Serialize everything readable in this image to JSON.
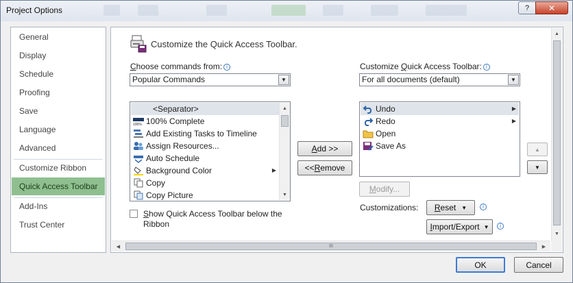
{
  "window": {
    "title": "Project Options",
    "help_label": "?",
    "close_label": "✕"
  },
  "nav": {
    "items": [
      {
        "label": "General"
      },
      {
        "label": "Display"
      },
      {
        "label": "Schedule"
      },
      {
        "label": "Proofing"
      },
      {
        "label": "Save"
      },
      {
        "label": "Language"
      },
      {
        "label": "Advanced"
      },
      {
        "label": "Customize Ribbon"
      },
      {
        "label": "Quick Access Toolbar",
        "active": true
      },
      {
        "label": "Add-Ins"
      },
      {
        "label": "Trust Center"
      }
    ]
  },
  "content": {
    "heading": "Customize the Quick Access Toolbar.",
    "choose_label_u": "C",
    "choose_label_rest": "hoose commands from:",
    "choose_value": "Popular Commands",
    "customize_label_pre": "Customize ",
    "customize_label_u": "Q",
    "customize_label_rest": "uick Access Toolbar:",
    "customize_value": "For all documents (default)",
    "commands": [
      {
        "label": "<Separator>",
        "icon": "none",
        "selected": true
      },
      {
        "label": "100% Complete",
        "icon": "percent-complete-icon"
      },
      {
        "label": "Add Existing Tasks to Timeline",
        "icon": "timeline-icon"
      },
      {
        "label": "Assign Resources...",
        "icon": "resources-icon"
      },
      {
        "label": "Auto Schedule",
        "icon": "auto-schedule-icon"
      },
      {
        "label": "Background Color",
        "icon": "paint-bucket-icon",
        "submenu": true
      },
      {
        "label": "Copy",
        "icon": "copy-icon"
      },
      {
        "label": "Copy Picture",
        "icon": "copy-picture-icon"
      }
    ],
    "toolbar_items": [
      {
        "label": "Undo",
        "icon": "undo-icon",
        "submenu": true,
        "selected": true
      },
      {
        "label": "Redo",
        "icon": "redo-icon",
        "submenu": true
      },
      {
        "label": "Open",
        "icon": "folder-icon"
      },
      {
        "label": "Save As",
        "icon": "save-as-icon"
      }
    ],
    "add_button_u": "A",
    "add_button_rest": "dd >>",
    "remove_button_pre": "<< ",
    "remove_button_u": "R",
    "remove_button_rest": "emove",
    "modify_button_u": "M",
    "modify_button_rest": "odify...",
    "show_below_u": "S",
    "show_below_line1_rest": "how Quick Access Toolbar below the",
    "show_below_line2": "Ribbon",
    "customizations_label": "Customizations:",
    "reset_u": "R",
    "reset_rest": "eset",
    "import_u": "I",
    "import_rest": "mport/Export",
    "info_glyph": "i",
    "hscroll_grip": "III"
  },
  "footer": {
    "ok_label": "OK",
    "cancel_label": "Cancel"
  },
  "colors": {
    "active_nav": "#8fbf8f",
    "close_button": "#c7432a",
    "info_icon": "#3a78c2"
  }
}
